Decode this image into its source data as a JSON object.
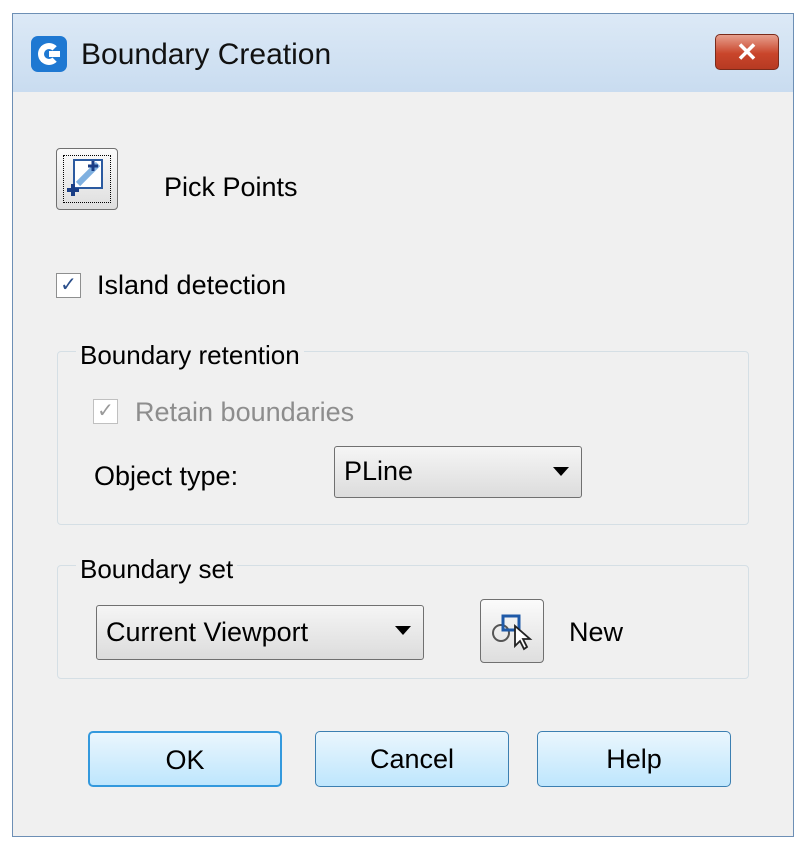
{
  "window": {
    "title": "Boundary Creation",
    "close_glyph": "✕",
    "app_icon": "app-logo-icon"
  },
  "pick_points": {
    "label": "Pick Points",
    "icon": "pick-points-icon"
  },
  "island_detection": {
    "label": "Island detection",
    "checked": true
  },
  "boundary_retention": {
    "legend": "Boundary retention",
    "retain": {
      "label": "Retain boundaries",
      "checked": true,
      "enabled": false
    },
    "object_type": {
      "label": "Object type:",
      "value": "PLine"
    }
  },
  "boundary_set": {
    "legend": "Boundary set",
    "value": "Current Viewport",
    "new_label": "New",
    "new_icon": "select-objects-icon"
  },
  "buttons": {
    "ok": "OK",
    "cancel": "Cancel",
    "help": "Help"
  },
  "colors": {
    "accent": "#3399dd",
    "close": "#c9452b",
    "titlebar": "#c9dcf0"
  }
}
